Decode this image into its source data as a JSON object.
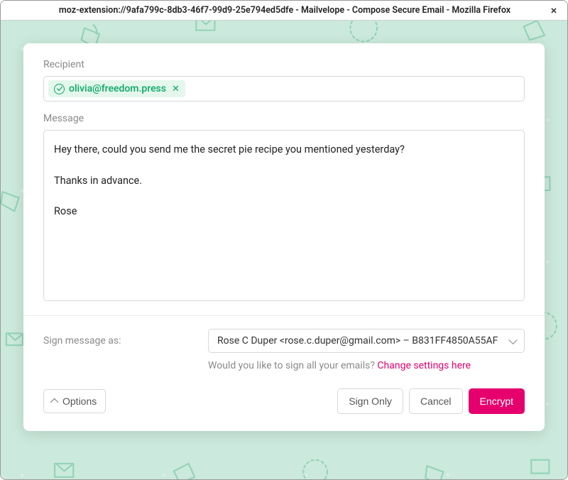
{
  "window": {
    "title": "moz-extension://9afa799c-8db3-46f7-99d9-25e794ed5dfe - Mailvelope - Compose Secure Email - Mozilla Firefox"
  },
  "compose": {
    "recipient_label": "Recipient",
    "recipient": {
      "email": "olivia@freedom.press"
    },
    "message_label": "Message",
    "message_body": "Hey there, could you send me the secret pie recipe you mentioned yesterday?\n\nThanks in advance.\n\nRose"
  },
  "sign": {
    "label": "Sign message as:",
    "selected": "Rose C Duper <rose.c.duper@gmail.com> – B831FF4850A55AF",
    "hint_text": "Would you like to sign all your emails? ",
    "hint_link": "Change settings here"
  },
  "buttons": {
    "options": "Options",
    "sign_only": "Sign Only",
    "cancel": "Cancel",
    "encrypt": "Encrypt"
  }
}
